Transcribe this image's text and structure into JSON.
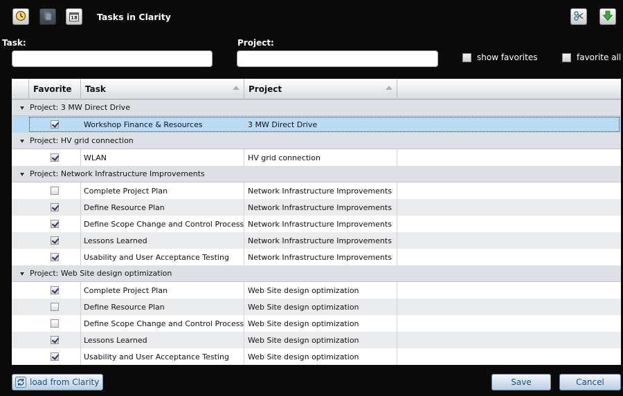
{
  "header": {
    "title": "Tasks in Clarity",
    "calendar_text": "18"
  },
  "filters": {
    "task_label": "Task:",
    "task_value": "",
    "project_label": "Project:",
    "project_value": "",
    "show_favorites_label": "show favorites",
    "show_favorites_checked": false,
    "favorite_all_label": "favorite all",
    "favorite_all_checked": false
  },
  "grid": {
    "columns": [
      "Favorite",
      "Task",
      "Project"
    ],
    "groups": [
      {
        "label": "Project: 3 MW Direct Drive",
        "rows": [
          {
            "favorite": true,
            "task": "Workshop Finance & Resources",
            "project": "3 MW Direct Drive",
            "selected": true
          }
        ]
      },
      {
        "label": "Project: HV grid connection",
        "rows": [
          {
            "favorite": true,
            "task": "WLAN",
            "project": "HV grid connection"
          }
        ]
      },
      {
        "label": "Project: Network Infrastructure Improvements",
        "rows": [
          {
            "favorite": false,
            "task": "Complete Project Plan",
            "project": "Network Infrastructure Improvements"
          },
          {
            "favorite": true,
            "task": "Define Resource Plan",
            "project": "Network Infrastructure Improvements"
          },
          {
            "favorite": true,
            "task": "Define Scope Change and Control Process",
            "project": "Network Infrastructure Improvements"
          },
          {
            "favorite": true,
            "task": "Lessons Learned",
            "project": "Network Infrastructure Improvements"
          },
          {
            "favorite": true,
            "task": "Usability and User Acceptance Testing",
            "project": "Network Infrastructure Improvements"
          }
        ]
      },
      {
        "label": "Project: Web Site design optimization",
        "rows": [
          {
            "favorite": true,
            "task": "Complete Project Plan",
            "project": "Web Site design optimization"
          },
          {
            "favorite": false,
            "task": "Define Resource Plan",
            "project": "Web Site design optimization"
          },
          {
            "favorite": false,
            "task": "Define Scope Change and Control Process",
            "project": "Web Site design optimization"
          },
          {
            "favorite": true,
            "task": "Lessons Learned",
            "project": "Web Site design optimization"
          },
          {
            "favorite": true,
            "task": "Usability and User Acceptance Testing",
            "project": "Web Site design optimization"
          }
        ]
      }
    ]
  },
  "footer": {
    "load_label": "load from Clarity",
    "save_label": "Save",
    "cancel_label": "Cancel"
  },
  "icons": {
    "clock": "clock-icon",
    "copy": "copy-icon",
    "calendar": "calendar-icon",
    "settings": "tools-icon",
    "download": "download-arrow-icon",
    "refresh": "refresh-icon"
  },
  "colors": {
    "background": "#0b0b0b",
    "selected_row": "#b9dcf6",
    "group_row": "#dde0e4",
    "alt_row": "#eaebed",
    "button_text": "#1d4f86",
    "download_green": "#3aa83a"
  }
}
